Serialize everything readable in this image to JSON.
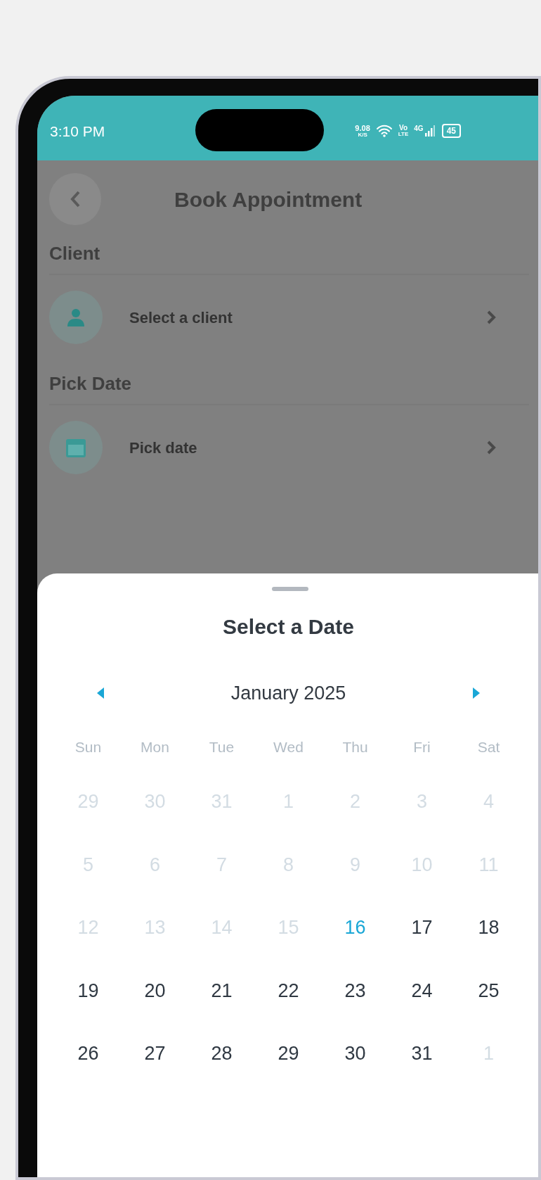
{
  "status_bar": {
    "time": "3:10 PM",
    "net_speed": "9.08",
    "net_unit": "K/S",
    "volte_top": "Vo",
    "volte_bottom": "LTE",
    "network": "4G",
    "battery": "45"
  },
  "background_screen": {
    "title": "Book Appointment",
    "sections": [
      {
        "heading": "Client",
        "row": {
          "kind": "person",
          "label": "Select a client"
        }
      },
      {
        "heading": "Pick Date",
        "row": {
          "kind": "calendar",
          "label": "Pick date"
        }
      }
    ]
  },
  "date_sheet": {
    "title": "Select a Date",
    "month": "January 2025",
    "weekdays": [
      "Sun",
      "Mon",
      "Tue",
      "Wed",
      "Thu",
      "Fri",
      "Sat"
    ],
    "days": [
      {
        "day": "29",
        "disabled": true,
        "today": false
      },
      {
        "day": "30",
        "disabled": true,
        "today": false
      },
      {
        "day": "31",
        "disabled": true,
        "today": false
      },
      {
        "day": "1",
        "disabled": true,
        "today": false
      },
      {
        "day": "2",
        "disabled": true,
        "today": false
      },
      {
        "day": "3",
        "disabled": true,
        "today": false
      },
      {
        "day": "4",
        "disabled": true,
        "today": false
      },
      {
        "day": "5",
        "disabled": true,
        "today": false
      },
      {
        "day": "6",
        "disabled": true,
        "today": false
      },
      {
        "day": "7",
        "disabled": true,
        "today": false
      },
      {
        "day": "8",
        "disabled": true,
        "today": false
      },
      {
        "day": "9",
        "disabled": true,
        "today": false
      },
      {
        "day": "10",
        "disabled": true,
        "today": false
      },
      {
        "day": "11",
        "disabled": true,
        "today": false
      },
      {
        "day": "12",
        "disabled": true,
        "today": false
      },
      {
        "day": "13",
        "disabled": true,
        "today": false
      },
      {
        "day": "14",
        "disabled": true,
        "today": false
      },
      {
        "day": "15",
        "disabled": true,
        "today": false
      },
      {
        "day": "16",
        "disabled": false,
        "today": true
      },
      {
        "day": "17",
        "disabled": false,
        "today": false
      },
      {
        "day": "18",
        "disabled": false,
        "today": false
      },
      {
        "day": "19",
        "disabled": false,
        "today": false
      },
      {
        "day": "20",
        "disabled": false,
        "today": false
      },
      {
        "day": "21",
        "disabled": false,
        "today": false
      },
      {
        "day": "22",
        "disabled": false,
        "today": false
      },
      {
        "day": "23",
        "disabled": false,
        "today": false
      },
      {
        "day": "24",
        "disabled": false,
        "today": false
      },
      {
        "day": "25",
        "disabled": false,
        "today": false
      },
      {
        "day": "26",
        "disabled": false,
        "today": false
      },
      {
        "day": "27",
        "disabled": false,
        "today": false
      },
      {
        "day": "28",
        "disabled": false,
        "today": false
      },
      {
        "day": "29",
        "disabled": false,
        "today": false
      },
      {
        "day": "30",
        "disabled": false,
        "today": false
      },
      {
        "day": "31",
        "disabled": false,
        "today": false
      },
      {
        "day": "1",
        "disabled": true,
        "today": false
      }
    ]
  }
}
